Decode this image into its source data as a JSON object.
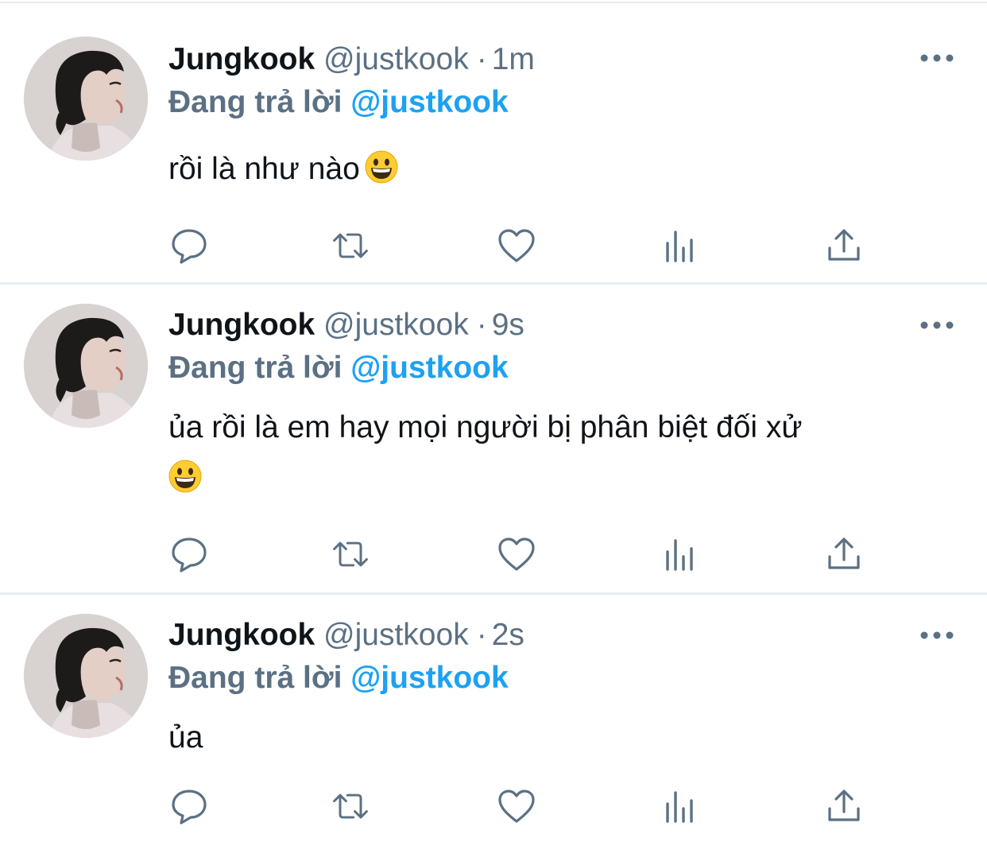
{
  "tweets": [
    {
      "display_name": "Jungkook",
      "handle": "@justkook",
      "separator": "·",
      "time": "1m",
      "reply_prefix": "Đang trả lời",
      "reply_to": "@justkook",
      "text": "rồi là như nào",
      "emoji": "grinning-face"
    },
    {
      "display_name": "Jungkook",
      "handle": "@justkook",
      "separator": "·",
      "time": "9s",
      "reply_prefix": "Đang trả lời",
      "reply_to": "@justkook",
      "text": "ủa rồi là em hay mọi người bị phân biệt đối xử",
      "emoji": "grinning-face"
    },
    {
      "display_name": "Jungkook",
      "handle": "@justkook",
      "separator": "·",
      "time": "2s",
      "reply_prefix": "Đang trả lời",
      "reply_to": "@justkook",
      "text": "ủa",
      "emoji": ""
    }
  ],
  "icons": {
    "reply": "reply-icon",
    "retweet": "retweet-icon",
    "like": "like-icon",
    "analytics": "analytics-icon",
    "share": "share-icon",
    "more": "more-icon"
  },
  "colors": {
    "text": "#0f1419",
    "secondary": "#5b7083",
    "link": "#1da1f2",
    "divider": "#e6ecf0"
  }
}
